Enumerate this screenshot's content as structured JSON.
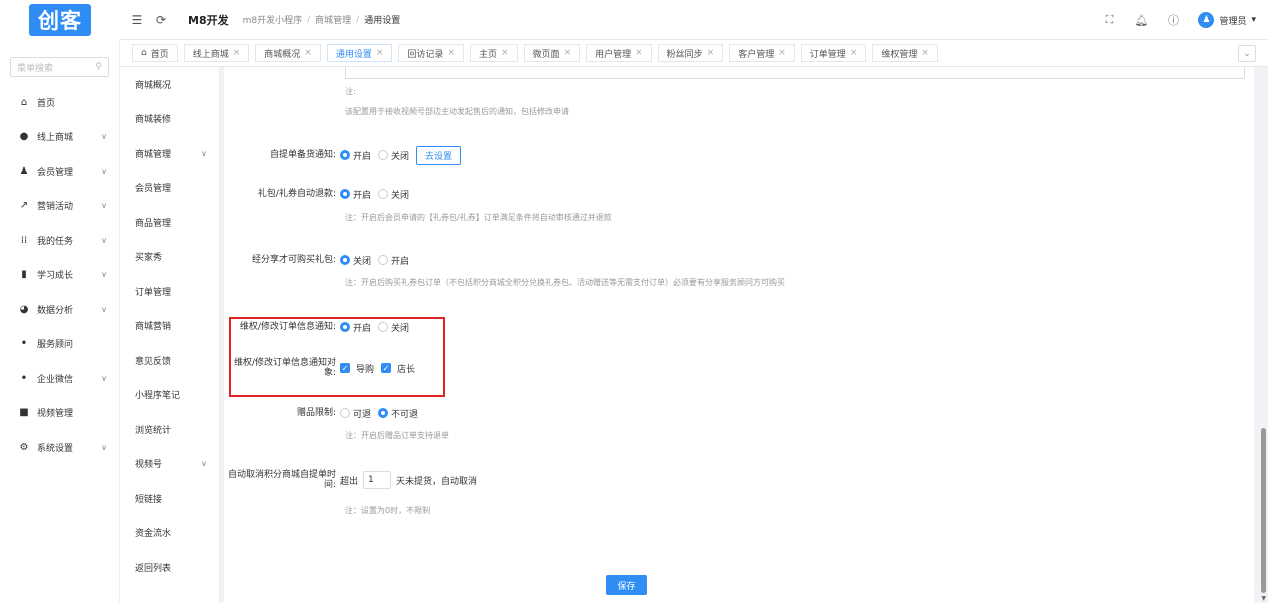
{
  "logo": "创客",
  "app_name": "M8开发",
  "breadcrumb": [
    "m8开发小程序",
    "商城管理",
    "通用设置"
  ],
  "user": {
    "name": "管理员"
  },
  "tabs": [
    {
      "label": "首页",
      "close": ""
    },
    {
      "label": "线上商城",
      "close": "×"
    },
    {
      "label": "商城概况",
      "close": "×"
    },
    {
      "label": "通用设置",
      "close": "×"
    },
    {
      "label": "回访记录",
      "close": "×"
    },
    {
      "label": "主页",
      "close": "×"
    },
    {
      "label": "微页面",
      "close": "×"
    },
    {
      "label": "用户管理",
      "close": "×"
    },
    {
      "label": "粉丝同步",
      "close": "×"
    },
    {
      "label": "客户管理",
      "close": "×"
    },
    {
      "label": "订单管理",
      "close": "×"
    },
    {
      "label": "维权管理",
      "close": "×"
    }
  ],
  "search_placeholder": "菜单搜索",
  "nav": [
    {
      "label": "首页",
      "icon": "home-icon"
    },
    {
      "label": "线上商城",
      "icon": "shop-icon"
    },
    {
      "label": "会员管理",
      "icon": "user-icon"
    },
    {
      "label": "营销活动",
      "icon": "chart-icon"
    },
    {
      "label": "我的任务",
      "icon": "grid-icon"
    },
    {
      "label": "学习成长",
      "icon": "book-icon"
    },
    {
      "label": "数据分析",
      "icon": "pie-icon"
    },
    {
      "label": "服务顾问",
      "icon": "people-icon"
    },
    {
      "label": "企业微信",
      "icon": "people-icon"
    },
    {
      "label": "视频管理",
      "icon": "video-icon"
    },
    {
      "label": "系统设置",
      "icon": "gear-icon"
    }
  ],
  "submenu": [
    "商城概况",
    "商城装修",
    "商城管理",
    "会员管理",
    "商品管理",
    "买家秀",
    "订单管理",
    "商城营销",
    "意见反馈",
    "小程序笔记",
    "浏览统计",
    "视频号",
    "短链接",
    "资金流水",
    "返回列表"
  ],
  "form": {
    "note0_label": "注:",
    "note0_text": "该配置用于接收视频号部边主动发起售后的通知，包括修改申请",
    "pickup_label": "自提单备货通知:",
    "pickup_on": "开启",
    "pickup_off": "关闭",
    "pickup_btn": "去设置",
    "gift_label": "礼包/礼券自动退款:",
    "gift_on": "开启",
    "gift_off": "关闭",
    "gift_note": "注：开启后会员申请的【礼券包/礼券】订单满足条件将自动审核通过并退款",
    "share_label": "经分享才可购买礼包:",
    "share_off": "关闭",
    "share_on": "开启",
    "share_note": "注：开启后购买礼券包订单（不包括积分商城全积分兑换礼券包、活动赠送等无需支付订单）必须要有分享服务顾问方可购买",
    "rights_label": "维权/修改订单信息通知:",
    "rights_on": "开启",
    "rights_off": "关闭",
    "target_label": "维权/修改订单信息通知对象:",
    "target_a": "导购",
    "target_b": "店长",
    "giftlimit_label": "赠品限制:",
    "giftlimit_a": "可退",
    "giftlimit_b": "不可退",
    "giftlimit_note": "注：开启后赠品订单支持退单",
    "auto_label": "自动取消积分商城自提单时间:",
    "auto_prefix": "超出",
    "auto_value": "1",
    "auto_suffix": "天未提货，自动取消",
    "auto_note": "注：设置为0时，不限制"
  },
  "save": "保存"
}
